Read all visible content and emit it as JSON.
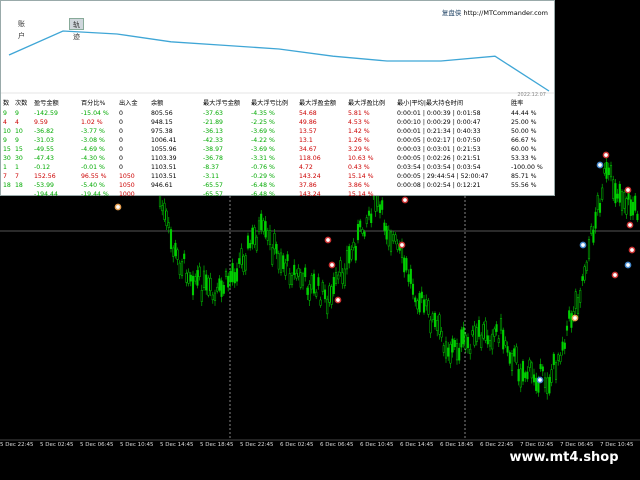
{
  "panel": {
    "tabs": [
      "",
      "账户",
      "轨迹"
    ],
    "active_tab": 2,
    "brand_cn": "复盘侠",
    "brand_url": "http://MTCommander.com",
    "eq_date": "2022.12.07",
    "equity_curve": [
      0.6,
      1.0,
      0.95,
      0.82,
      0.76,
      0.7,
      0.58,
      0.5,
      0.5,
      0.58,
      0.0
    ],
    "headers": [
      "数",
      "次数",
      "盈亏金额",
      "百分比%",
      "出入金",
      "余额",
      "最大浮亏金额",
      "最大浮亏比例",
      "最大浮盈金额",
      "最大浮盈比例",
      "最小|平均|最大持仓时间",
      "胜率"
    ],
    "rows": [
      {
        "c": [
          "9",
          "9",
          "-142.59",
          "-15.04 %",
          "0",
          "805.56",
          "-37.63",
          "-4.35 %",
          "54.68",
          "5.81 %",
          "0:00:01 | 0:00:39 | 0:01:58",
          "44.44 %"
        ],
        "colors": [
          "#0a0",
          "#0a0",
          "#0a0",
          "#0a0",
          "#000",
          "#000",
          "#0a0",
          "#0a0",
          "#c00",
          "#c00",
          "#000",
          "#000"
        ]
      },
      {
        "c": [
          "4",
          "4",
          "9.59",
          "1.02 %",
          "0",
          "948.15",
          "-21.89",
          "-2.25 %",
          "49.86",
          "4.53 %",
          "0:00:10 | 0:00:29 | 0:00:47",
          "25.00 %"
        ],
        "colors": [
          "#c00",
          "#c00",
          "#c00",
          "#c00",
          "#000",
          "#000",
          "#0a0",
          "#0a0",
          "#c00",
          "#c00",
          "#000",
          "#000"
        ]
      },
      {
        "c": [
          "10",
          "10",
          "-36.82",
          "-3.77 %",
          "0",
          "975.38",
          "-36.13",
          "-3.69 %",
          "13.57",
          "1.42 %",
          "0:00:01 | 0:21:34 | 0:40:33",
          "50.00 %"
        ],
        "colors": [
          "#0a0",
          "#0a0",
          "#0a0",
          "#0a0",
          "#000",
          "#000",
          "#0a0",
          "#0a0",
          "#c00",
          "#c00",
          "#000",
          "#000"
        ]
      },
      {
        "c": [
          "9",
          "9",
          "-31.03",
          "-3.08 %",
          "0",
          "1006.41",
          "-42.33",
          "-4.22 %",
          "13.1",
          "1.26 %",
          "0:00:05 | 0:02:17 | 0:07:50",
          "66.67 %"
        ],
        "colors": [
          "#0a0",
          "#0a0",
          "#0a0",
          "#0a0",
          "#000",
          "#000",
          "#0a0",
          "#0a0",
          "#c00",
          "#c00",
          "#000",
          "#000"
        ]
      },
      {
        "c": [
          "15",
          "15",
          "-49.55",
          "-4.69 %",
          "0",
          "1055.96",
          "-38.97",
          "-3.69 %",
          "34.67",
          "3.29 %",
          "0:00:03 | 0:03:01 | 0:21:53",
          "60.00 %"
        ],
        "colors": [
          "#0a0",
          "#0a0",
          "#0a0",
          "#0a0",
          "#000",
          "#000",
          "#0a0",
          "#0a0",
          "#c00",
          "#c00",
          "#000",
          "#000"
        ]
      },
      {
        "c": [
          "30",
          "30",
          "-47.43",
          "-4.30 %",
          "0",
          "1103.39",
          "-36.78",
          "-3.31 %",
          "118.06",
          "10.63 %",
          "0:00:05 | 0:02:26 | 0:21:51",
          "53.33 %"
        ],
        "colors": [
          "#0a0",
          "#0a0",
          "#0a0",
          "#0a0",
          "#000",
          "#000",
          "#0a0",
          "#0a0",
          "#c00",
          "#c00",
          "#000",
          "#000"
        ]
      },
      {
        "c": [
          "1",
          "1",
          "-0.12",
          "-0.01 %",
          "0",
          "1103.51",
          "-8.37",
          "-0.76 %",
          "4.72",
          "0.43 %",
          "0:03:54 | 0:03:54 | 0:03:54",
          "-100.00 %"
        ],
        "colors": [
          "#0a0",
          "#0a0",
          "#0a0",
          "#0a0",
          "#000",
          "#000",
          "#0a0",
          "#0a0",
          "#c00",
          "#c00",
          "#000",
          "#000"
        ]
      },
      {
        "c": [
          "7",
          "7",
          "152.56",
          "96.55 %",
          "1050",
          "1103.51",
          "-3.11",
          "-0.29 %",
          "143.24",
          "15.14 %",
          "0:00:05 | 29:44:54 | 52:00:47",
          "85.71 %"
        ],
        "colors": [
          "#c00",
          "#c00",
          "#c00",
          "#c00",
          "#c00",
          "#000",
          "#0a0",
          "#0a0",
          "#c00",
          "#c00",
          "#000",
          "#000"
        ]
      },
      {
        "c": [
          "18",
          "18",
          "-53.99",
          "-5.40 %",
          "1050",
          "946.61",
          "-65.57",
          "-6.48 %",
          "37.86",
          "3.86 %",
          "0:00:08 | 0:02:54 | 0:12:21",
          "55.56 %"
        ],
        "colors": [
          "#0a0",
          "#0a0",
          "#0a0",
          "#0a0",
          "#c00",
          "#000",
          "#0a0",
          "#0a0",
          "#c00",
          "#c00",
          "#000",
          "#000"
        ]
      },
      {
        "c": [
          "",
          "",
          "-194.44",
          "-19.44 %",
          "1000",
          "",
          "-65.57",
          "-6.48 %",
          "143.24",
          "15.14 %",
          "",
          ""
        ],
        "colors": [
          "#0a0",
          "#0a0",
          "#0a0",
          "#0a0",
          "#c00",
          "#000",
          "#0a0",
          "#0a0",
          "#c00",
          "#c00",
          "#000",
          "#000"
        ]
      }
    ]
  },
  "x_labels": [
    "5 Dec 22:45",
    "5 Dec 02:45",
    "5 Dec 06:45",
    "5 Dec 10:45",
    "5 Dec 14:45",
    "5 Dec 18:45",
    "5 Dec 22:45",
    "6 Dec 02:45",
    "6 Dec 06:45",
    "6 Dec 10:45",
    "6 Dec 14:45",
    "6 Dec 18:45",
    "6 Dec 22:45",
    "7 Dec 02:45",
    "7 Dec 06:45",
    "7 Dec 10:45"
  ],
  "watermark": "www.mt4.shop",
  "colors": {
    "candle": "#00d000",
    "up_text": "#c00",
    "down_text": "#0a0",
    "eq_line": "#3fa6d6"
  }
}
